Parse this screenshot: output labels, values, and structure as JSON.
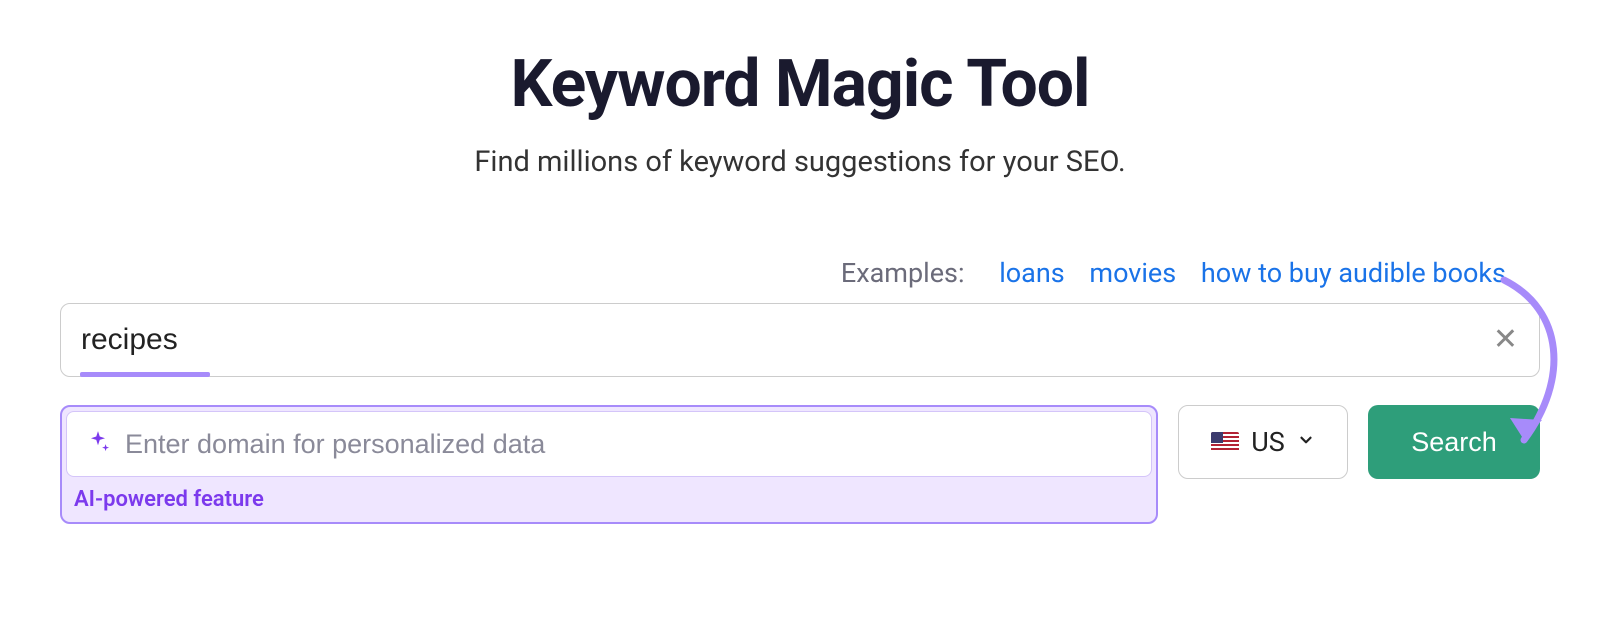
{
  "header": {
    "title": "Keyword Magic Tool",
    "subtitle": "Find millions of keyword suggestions for your SEO."
  },
  "examples": {
    "label": "Examples:",
    "items": [
      "loans",
      "movies",
      "how to buy audible books"
    ]
  },
  "keyword": {
    "value": "recipes"
  },
  "domain": {
    "placeholder": "Enter domain for personalized data",
    "ai_label": "AI-powered feature"
  },
  "country": {
    "code": "US"
  },
  "actions": {
    "search_label": "Search"
  }
}
